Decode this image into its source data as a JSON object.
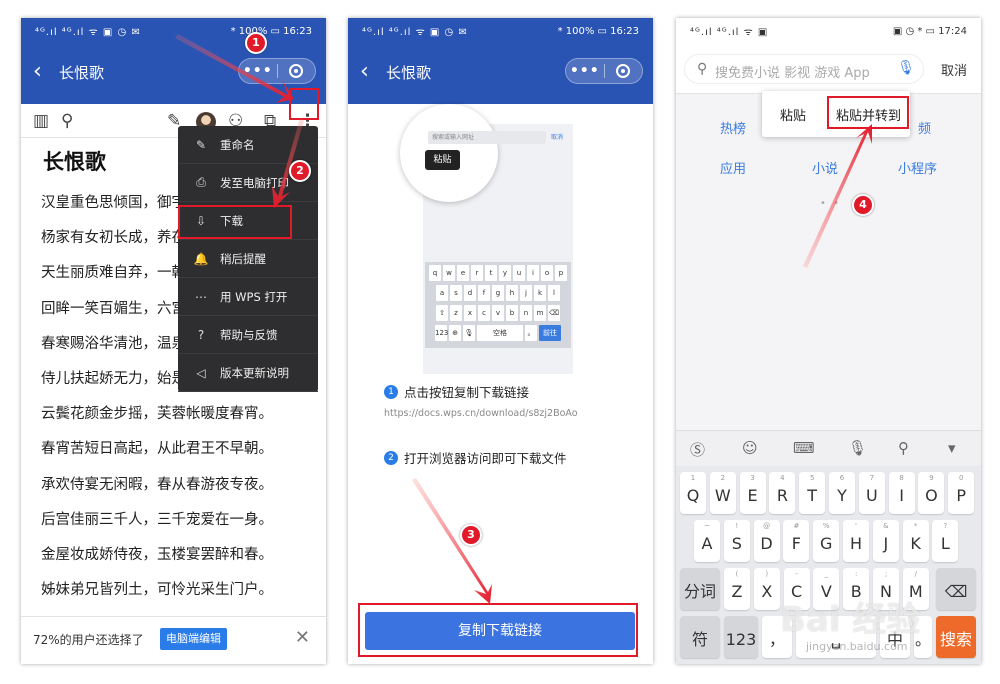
{
  "phone1": {
    "status": {
      "signal": "⁴ᴳ.ıl ⁴ᴳ.ıl ᯤ ▣ ◷ ✉",
      "right": "* 100% ▭ 16:23"
    },
    "title": "长恨歌",
    "doc_title": "长恨歌",
    "poem_lines": [
      "汉皇重色思倾国，御宇多年求不得。",
      "杨家有女初长成，养在深闺人未识。",
      "天生丽质难自弃，一朝选在君王侧。",
      "回眸一笑百媚生，六宫粉黛无颜色。",
      "春寒赐浴华清池，温泉水滑洗凝脂。",
      "侍儿扶起娇无力，始是新承恩泽时。",
      "云鬓花颜金步摇，芙蓉帐暖度春宵。",
      "春宵苦短日高起，从此君王不早朝。",
      "承欢侍宴无闲暇，春从春游夜专夜。",
      "后宫佳丽三千人，三千宠爱在一身。",
      "金屋妆成娇侍夜，玉楼宴罢醉和春。",
      "姊妹弟兄皆列土，可怜光采生门户。"
    ],
    "menu": [
      {
        "icon": "✎",
        "label": "重命名"
      },
      {
        "icon": "⎙",
        "label": "发至电脑打印"
      },
      {
        "icon": "⇩",
        "label": "下载"
      },
      {
        "icon": "🔔",
        "label": "稍后提醒"
      },
      {
        "icon": "⋯",
        "label": "用 WPS 打开"
      },
      {
        "icon": "?",
        "label": "帮助与反馈"
      },
      {
        "icon": "◁",
        "label": "版本更新说明"
      }
    ],
    "bottom_text": "72%的用户还选择了",
    "bottom_button": "电脑端编辑"
  },
  "phone2": {
    "status": {
      "signal": "⁴ᴳ.ıl ⁴ᴳ.ıl ᯤ ▣ ◷ ✉",
      "right": "* 100% ▭ 16:23"
    },
    "title": "长恨歌",
    "illus_placeholder": "搜索或输入网址",
    "illus_cancel": "取消",
    "illus_tooltip": "粘贴",
    "kb_row1": [
      "q",
      "w",
      "e",
      "r",
      "t",
      "y",
      "u",
      "i",
      "o",
      "p"
    ],
    "kb_row2": [
      "a",
      "s",
      "d",
      "f",
      "g",
      "h",
      "j",
      "k",
      "l"
    ],
    "kb_row3": [
      "⇧",
      "z",
      "x",
      "c",
      "v",
      "b",
      "n",
      "m",
      "⌫"
    ],
    "kb_space": "空格",
    "kb_go": "前往",
    "step1": "点击按钮复制下载链接",
    "url": "https://docs.wps.cn/download/s8zj2BoAo",
    "step2": "打开浏览器访问即可下载文件",
    "copy_button": "复制下载链接"
  },
  "phone3": {
    "status": {
      "signal": "⁴ᴳ.ıl ⁴ᴳ.ıl ᯤ ▣",
      "right": "▣ ◷ * ▭ 17:24"
    },
    "search_placeholder": "搜免费小说 影视 游戏 App",
    "cancel": "取消",
    "paste": "粘贴",
    "paste_go": "粘贴并转到",
    "links": [
      "热榜",
      "频",
      "应用",
      "小说",
      "小程序"
    ],
    "dots": "• •",
    "row1": [
      [
        "1",
        "Q"
      ],
      [
        "2",
        "W"
      ],
      [
        "3",
        "E"
      ],
      [
        "4",
        "R"
      ],
      [
        "5",
        "T"
      ],
      [
        "6",
        "Y"
      ],
      [
        "7",
        "U"
      ],
      [
        "8",
        "I"
      ],
      [
        "9",
        "O"
      ],
      [
        "0",
        "P"
      ]
    ],
    "row2": [
      [
        "~",
        "A"
      ],
      [
        "!",
        "S"
      ],
      [
        "@",
        "D"
      ],
      [
        "#",
        "F"
      ],
      [
        "%",
        "G"
      ],
      [
        "'",
        "H"
      ],
      [
        "&",
        "J"
      ],
      [
        "*",
        "K"
      ],
      [
        "?",
        "L"
      ]
    ],
    "row3": [
      [
        "(",
        "Z"
      ],
      [
        ")",
        "X"
      ],
      [
        "-",
        "C"
      ],
      [
        "_",
        "V"
      ],
      [
        ":",
        "B"
      ],
      [
        ";",
        "N"
      ],
      [
        "/",
        "M"
      ]
    ],
    "key_fenci": "分词",
    "key_fu": "符",
    "key_123": "123",
    "key_search": "搜索"
  },
  "watermark": {
    "text": "Bai 经验",
    "sub": "jingyan.baidu.com"
  },
  "badges": [
    "1",
    "2",
    "3",
    "4"
  ]
}
